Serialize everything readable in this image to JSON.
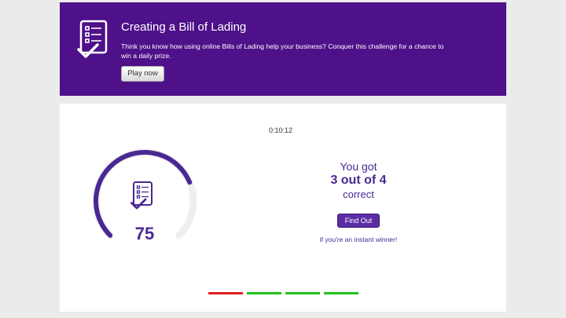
{
  "banner": {
    "icon": "checklist-icon",
    "title": "Creating a Bill of Lading",
    "description": "Think you know how using online Bills of Lading help your business? Conquer this challenge for a chance to win a daily prize.",
    "play_label": "Play now",
    "color": "#4e1189"
  },
  "quiz": {
    "timer": "0:10:12",
    "score": "75",
    "score_fraction": 0.75,
    "gauge_color": "#4a2893",
    "result": {
      "you_got": "You got",
      "score_line": "3 out of 4",
      "correct": "correct"
    },
    "find_out_label": "Find Out",
    "winner_text": "if you're an instant winner!",
    "progress": [
      {
        "status": "incorrect",
        "color": "#e02020"
      },
      {
        "status": "correct",
        "color": "#1fc31f"
      },
      {
        "status": "correct",
        "color": "#1fc31f"
      },
      {
        "status": "correct",
        "color": "#1fc31f"
      }
    ]
  }
}
